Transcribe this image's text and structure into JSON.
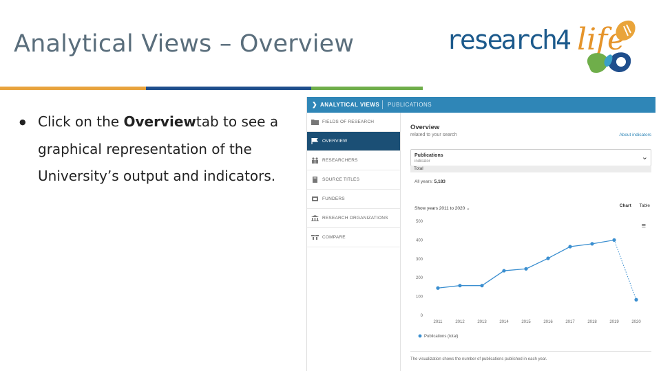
{
  "slide": {
    "title": "Analytical Views – Overview",
    "bullet_dot": "●",
    "bullet_pre": "Click on the ",
    "bullet_bold": "Overview",
    "bullet_post": "tab to see a graphical representation of the University’s output and indicators."
  },
  "logo": {
    "text": "research4",
    "life": "life"
  },
  "colors": {
    "title": "#5a6e7c",
    "bar_orange": "#e8a33d",
    "bar_navy": "#1f4e8c",
    "bar_green": "#6fae4a",
    "header_blue": "#2f86b7",
    "nav_active": "#1b4f75",
    "series": "#3b8fd0"
  },
  "app": {
    "breadcrumb": "ANALYTICAL VIEWS",
    "breadcrumb_tab": "PUBLICATIONS",
    "sidebar": [
      {
        "label": "FIELDS OF RESEARCH",
        "icon": "folder-icon"
      },
      {
        "label": "OVERVIEW",
        "icon": "flag-icon",
        "active": true
      },
      {
        "label": "RESEARCHERS",
        "icon": "people-icon"
      },
      {
        "label": "SOURCE TITLES",
        "icon": "book-icon"
      },
      {
        "label": "FUNDERS",
        "icon": "funder-icon"
      },
      {
        "label": "RESEARCH ORGANIZATIONS",
        "icon": "building-icon"
      },
      {
        "label": "COMPARE",
        "icon": "compare-icon"
      }
    ],
    "overview_title": "Overview",
    "overview_sub": "related to your search",
    "about_link": "About indicators",
    "select_label": "Publications",
    "select_sub": "indicator",
    "select_option": "Total",
    "all_years_label": "All years:",
    "all_years_value": "5,183",
    "show_years": "Show years 2011 to 2020",
    "tab_chart": "Chart",
    "tab_table": "Table",
    "menu_icon": "≡",
    "footer_note": "The visualization shows the number of publications published in each year."
  },
  "chart_data": {
    "type": "line",
    "x": [
      "2011",
      "2012",
      "2013",
      "2014",
      "2015",
      "2016",
      "2017",
      "2018",
      "2019",
      "2020"
    ],
    "series": [
      {
        "name": "Publications (total)",
        "values": [
          145,
          158,
          158,
          237,
          247,
          303,
          365,
          380,
          400,
          83
        ]
      }
    ],
    "y_ticks": [
      0,
      100,
      200,
      300,
      400,
      500
    ],
    "ylim": [
      0,
      500
    ],
    "dotted_last_segment": true,
    "grid": false,
    "legend": "bottom-left"
  }
}
